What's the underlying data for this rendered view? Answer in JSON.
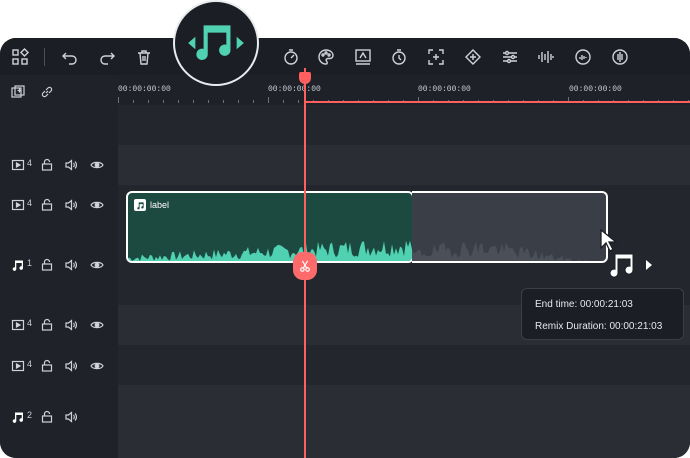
{
  "toolbar": {
    "icons": [
      "grid-icon",
      "undo-icon",
      "redo-icon",
      "trash-icon",
      "speed-icon",
      "color-palette-icon",
      "ai-portrait-icon",
      "timer-icon",
      "crop-icon",
      "keyframe-icon",
      "adjust-icon",
      "audio-wave-icon",
      "audio-stretch-icon",
      "voice-icon"
    ]
  },
  "ruler": {
    "labels": [
      "00:00:00:00",
      "00:00:00:00",
      "00:00:00:00",
      "00:00:00:00"
    ]
  },
  "tracks": [
    {
      "type": "video",
      "number": "4"
    },
    {
      "type": "video",
      "number": "4"
    },
    {
      "type": "audio",
      "number": "1"
    },
    {
      "type": "video",
      "number": "4"
    },
    {
      "type": "video",
      "number": "4"
    },
    {
      "type": "audio",
      "number": "2"
    }
  ],
  "clip": {
    "label": "label"
  },
  "tooltip": {
    "end_time": "End time: 00:00:21:03",
    "remix_duration": "Remix Duration: 00:00:21:03"
  },
  "colors": {
    "accent": "#4fd1b2",
    "playhead": "#ff5f5f",
    "clip_bg": "#1d4a40"
  }
}
